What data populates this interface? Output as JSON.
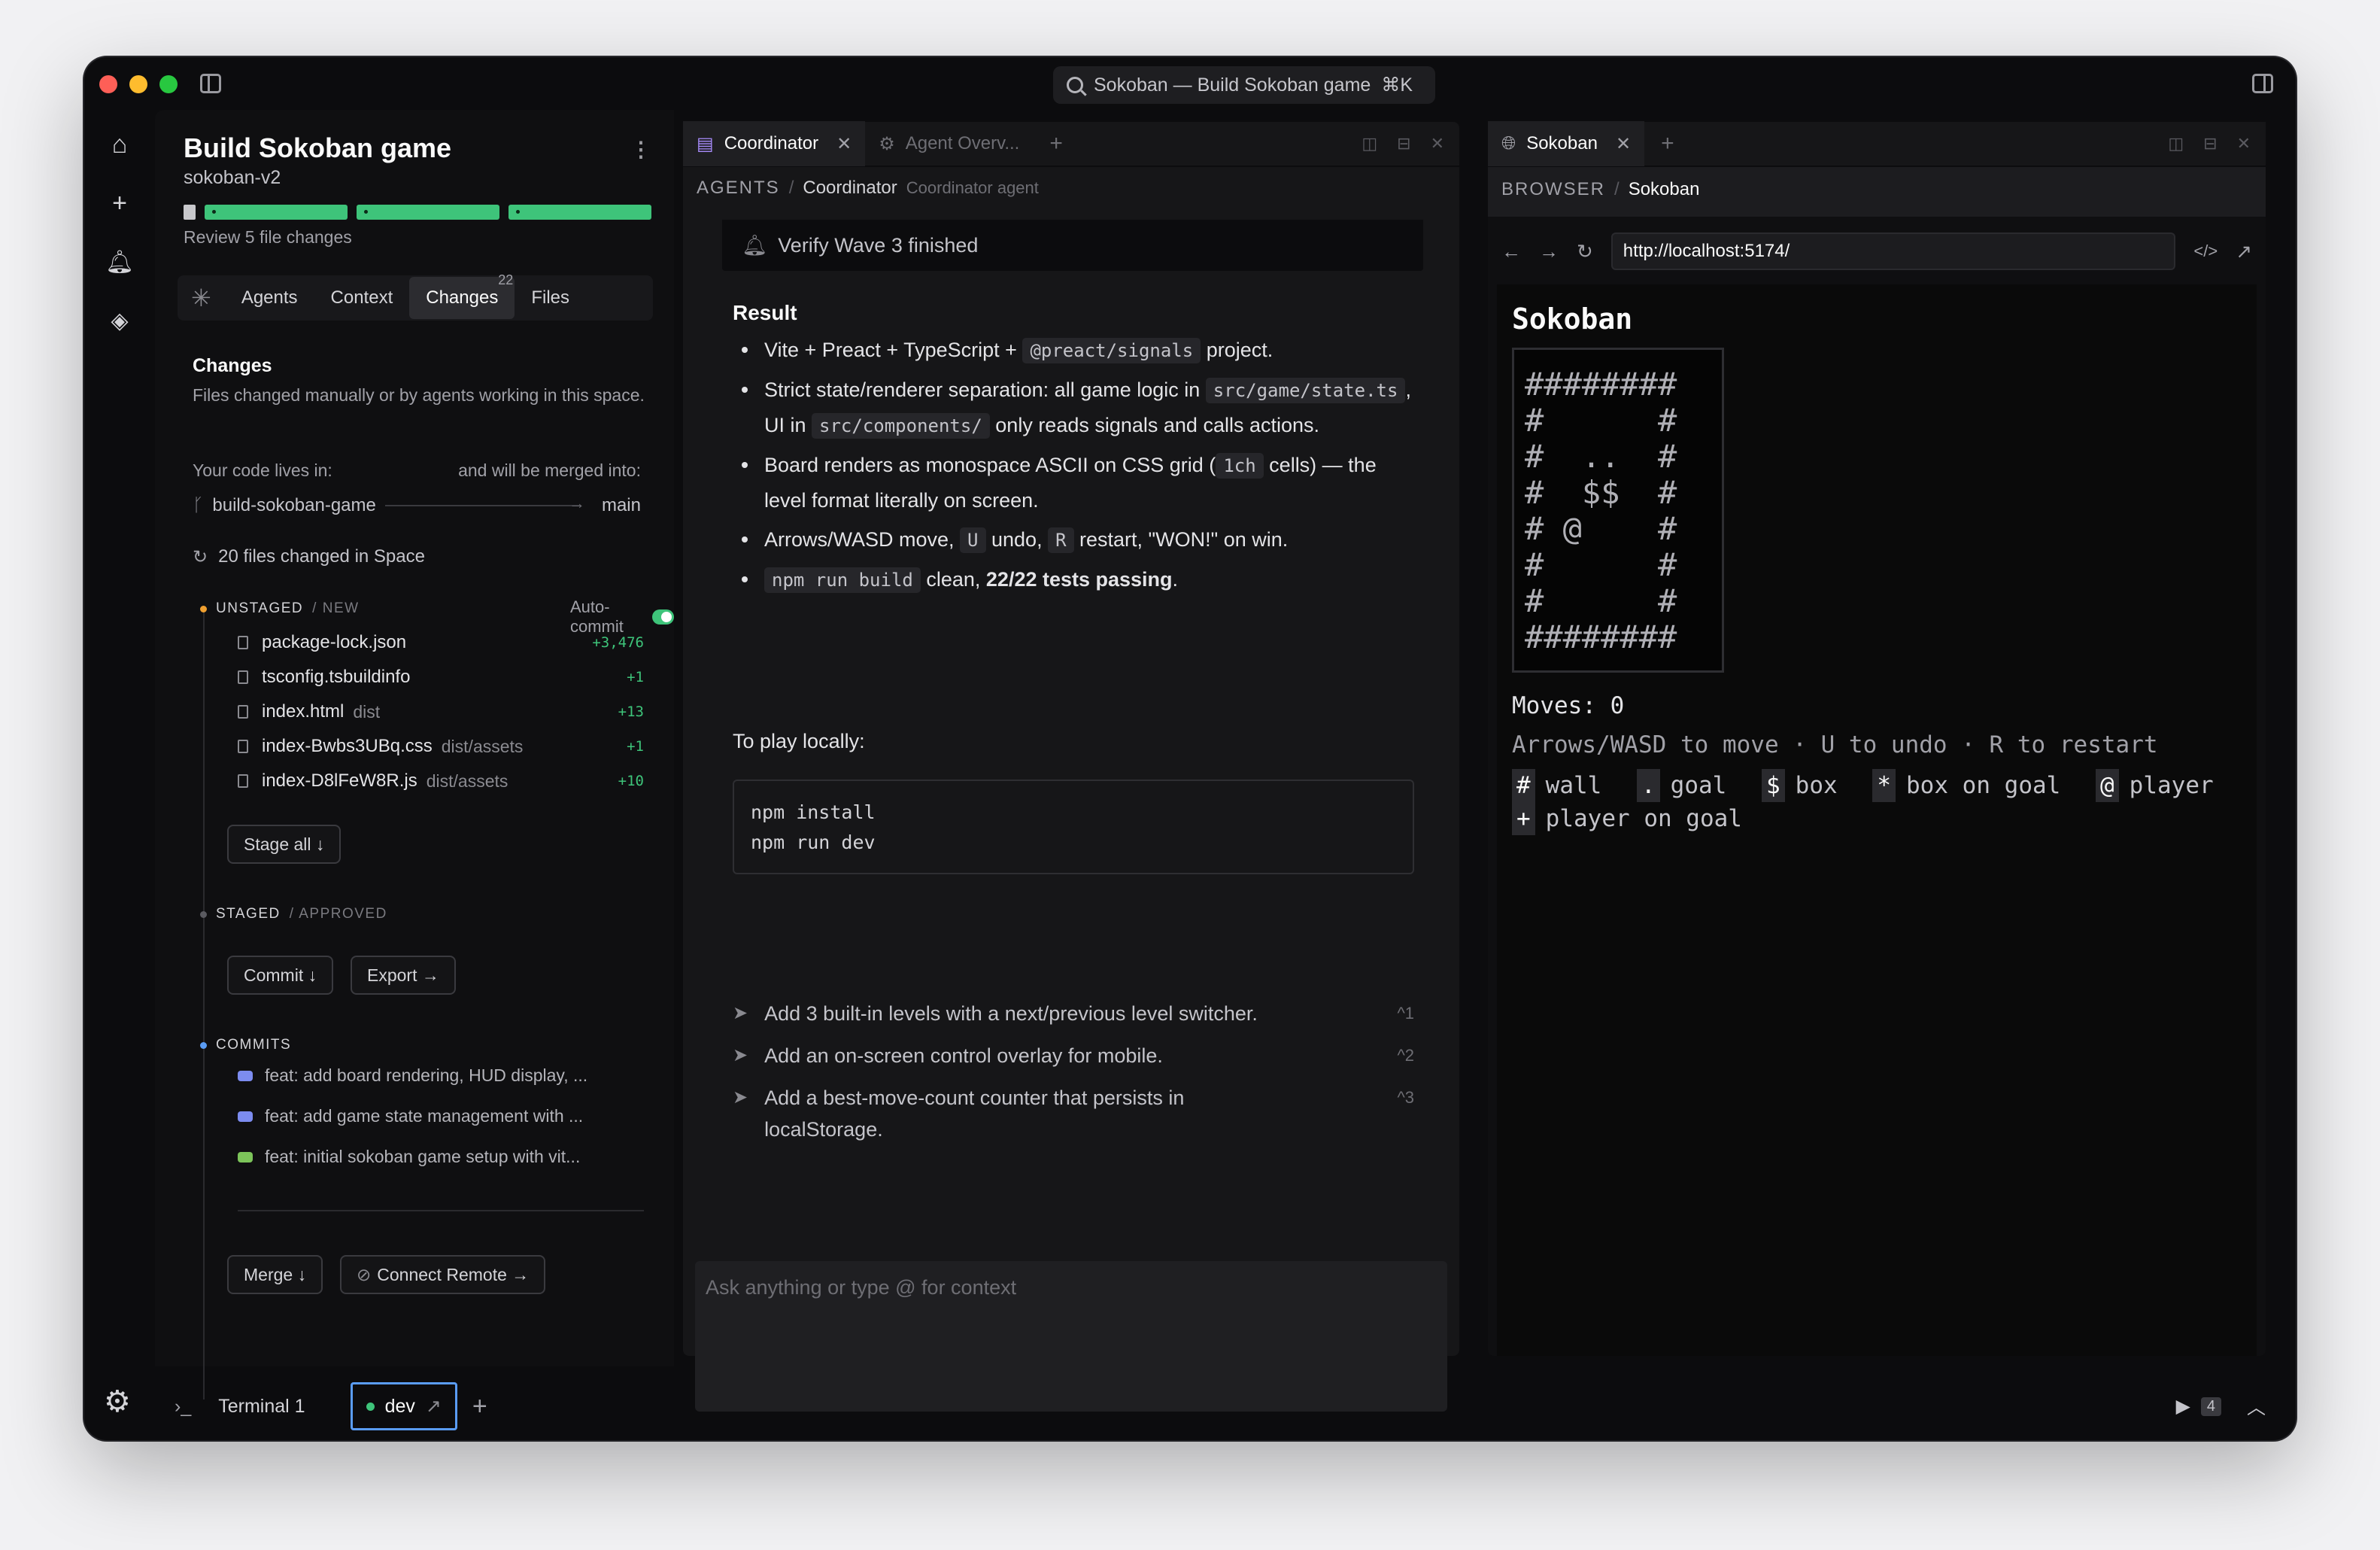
{
  "titlebar": {
    "search_text": "Sokoban — Build Sokoban game",
    "shortcut": "⌘K"
  },
  "project": {
    "title": "Build Sokoban game",
    "subtitle": "sokoban-v2",
    "review_text": "Review 5 file changes"
  },
  "left_tabs": [
    {
      "label": "Agents"
    },
    {
      "label": "Context"
    },
    {
      "label": "Changes",
      "badge": "22"
    },
    {
      "label": "Files"
    }
  ],
  "changes": {
    "title": "Changes",
    "description": "Files changed manually or by agents working in this space.",
    "lives_label": "Your code lives in:",
    "merged_label": "and will be merged into:",
    "source_branch": "build-sokoban-game",
    "target_branch": "main",
    "files_changed": "20 files changed in Space",
    "unstaged_label": "UNSTAGED",
    "unstaged_sub": "/ NEW",
    "autocommit_label": "Auto-commit",
    "files": [
      {
        "name": "package-lock.json",
        "dir": "",
        "count": "+3,476"
      },
      {
        "name": "tsconfig.tsbuildinfo",
        "dir": "",
        "count": "+1"
      },
      {
        "name": "index.html",
        "dir": "dist",
        "count": "+13"
      },
      {
        "name": "index-Bwbs3UBq.css",
        "dir": "dist/assets",
        "count": "+1"
      },
      {
        "name": "index-D8lFeW8R.js",
        "dir": "dist/assets",
        "count": "+10"
      }
    ],
    "stage_all": "Stage all ↓",
    "staged_label": "STAGED",
    "staged_sub": "/ APPROVED",
    "commit_btn": "Commit ↓",
    "export_btn": "Export →",
    "commits_label": "COMMITS",
    "commits": [
      "feat: add board rendering, HUD display, ...",
      "feat: add game state management with ...",
      "feat: initial sokoban game setup with vit..."
    ],
    "merge_btn": "Merge ↓",
    "connect_btn": "Connect Remote →"
  },
  "middle": {
    "tab_active": "Coordinator",
    "tab_inactive": "Agent Overv...",
    "crumb_root": "AGENTS",
    "crumb_current": "Coordinator",
    "crumb_hint": "Coordinator agent",
    "verify": "Verify Wave 3 finished",
    "result_heading": "Result",
    "bullets": {
      "b1_pre": "Vite + Preact + TypeScript + ",
      "b1_code": "@preact/signals",
      "b1_post": " project.",
      "b2_pre": "Strict state/renderer separation: all game logic in ",
      "b2_code1": "src/game/state.ts",
      "b2_mid": ", UI in ",
      "b2_code2": "src/components/",
      "b2_post": " only reads signals and calls actions.",
      "b3_pre": "Board renders as monospace ASCII on CSS grid (",
      "b3_code": "1ch",
      "b3_post": " cells) — the level format literally on screen.",
      "b4_pre": "Arrows/WASD move, ",
      "b4_code1": "U",
      "b4_mid": " undo, ",
      "b4_code2": "R",
      "b4_post": " restart, \"WON!\" on win.",
      "b5_code": "npm run build",
      "b5_mid": " clean, ",
      "b5_bold": "22/22 tests passing",
      "b5_post": "."
    },
    "play_label": "To play locally:",
    "code_block": "npm install\nnpm run dev",
    "suggestions": [
      {
        "text": "Add 3 built-in levels with a next/previous level switcher.",
        "key": "^1"
      },
      {
        "text": "Add an on-screen control overlay for mobile.",
        "key": "^2"
      },
      {
        "text": "Add a best-move-count counter that persists in localStorage.",
        "key": "^3"
      }
    ],
    "chat_placeholder": "Ask anything or type @ for context"
  },
  "browser": {
    "tab": "Sokoban",
    "crumb_root": "BROWSER",
    "crumb_current": "Sokoban",
    "url": "http://localhost:5174/",
    "page_title": "Sokoban",
    "board_rows": [
      "########",
      "#      #",
      "#  ..  #",
      "#  $$  #",
      "# @    #",
      "#      #",
      "#      #",
      "########"
    ],
    "moves": "Moves: 0",
    "instructions": "Arrows/WASD to move · U to undo · R to restart",
    "legend": [
      {
        "key": "#",
        "label": "wall"
      },
      {
        "key": ".",
        "label": "goal"
      },
      {
        "key": "$",
        "label": "box"
      },
      {
        "key": "*",
        "label": "box on goal"
      },
      {
        "key": "@",
        "label": "player"
      },
      {
        "key": "+",
        "label": "player on goal"
      }
    ]
  },
  "bottom": {
    "terminal": "Terminal 1",
    "dev_tab": "dev",
    "run_count": "4"
  },
  "colors": {
    "accent_green": "#3ec47a",
    "focus_blue": "#5a9cf5",
    "unstaged_dot": "#f0a030",
    "commit_dot": "#5a9cf5"
  }
}
